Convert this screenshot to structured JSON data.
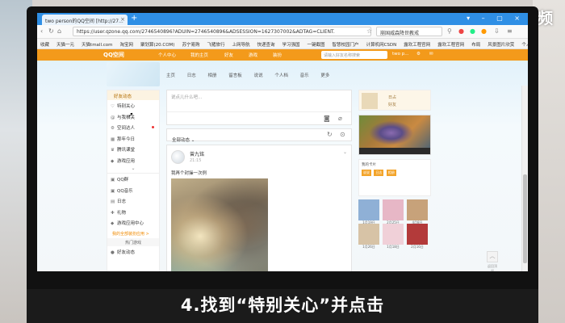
{
  "watermark": "天奇·视频",
  "caption": "4.找到“特别关心”并点击",
  "browser": {
    "tab_title": "two person的QQ空间 [http://27...",
    "url": "https://user.qzone.qq.com/2746540896?ADUIN=2746540896&ADSESSION=1627307002&ADTAG=CLIENT.",
    "search_placeholder": "崩国威森降世教戒",
    "bookmarks": [
      "收藏",
      "天猫一元",
      "天猫tmall.com",
      "淘宝网",
      "聚划算(20.COM)",
      "苏宁易购",
      "飞猪旅行",
      "上网导航",
      "快递查询",
      "学习强国",
      "一键截图",
      "智慧校园门户",
      "计算机网CSDN",
      "露欢工程官网",
      "露欢工程官网",
      "布局",
      "风景图片欣赏",
      "个人信息"
    ]
  },
  "qzone": {
    "logo": "QQ空间",
    "top_menu": [
      "个人中心",
      "我的主页",
      "好友",
      "游戏",
      "装扮"
    ],
    "search_placeholder": "请输入好友名称搜索",
    "user": "two p...",
    "nav": [
      "主页",
      "日志",
      "相册",
      "留言板",
      "说说",
      "个人档",
      "音乐",
      "更多"
    ]
  },
  "leftnav": {
    "header": "好友动态",
    "items": [
      {
        "icon": "heart-icon",
        "label": "特别关心",
        "dot": false
      },
      {
        "icon": "at-icon",
        "label": "与我相关",
        "dot": false
      },
      {
        "icon": "gear-icon",
        "label": "空间达人",
        "dot": true
      },
      {
        "icon": "calendar-icon",
        "label": "那年今日",
        "dot": false
      },
      {
        "icon": "trophy-icon",
        "label": "腾讯课堂",
        "dot": false
      },
      {
        "icon": "game-icon",
        "label": "游戏应用",
        "dot": false
      }
    ],
    "items2": [
      {
        "icon": "grid-icon",
        "label": "QQ群"
      },
      {
        "icon": "grid-icon",
        "label": "QQ音乐"
      },
      {
        "icon": "doc-icon",
        "label": "日志"
      },
      {
        "icon": "gift-icon",
        "label": "礼物"
      },
      {
        "icon": "game-icon",
        "label": "游戏应用中心"
      }
    ],
    "orange_link": "我的全部装扮应用 >",
    "sub_label": "热门游戏",
    "bottom_item": "好友动态"
  },
  "composer": {
    "placeholder": "说点儿什么吧..."
  },
  "feed": {
    "header": "全部动态",
    "chevron": "⌄"
  },
  "post": {
    "author": "曾九铭",
    "time": "21:15",
    "text": "我再个封操一次例"
  },
  "rightcol": {
    "box1_line1": "日占",
    "box1_line2": "好友",
    "sec_line1": "我的卡片",
    "sec_btns": [
      "说说",
      "日志",
      "相册"
    ],
    "tiles": [
      "1月19日",
      "2月25日",
      "4月8日",
      "1月26日",
      "1月18日",
      "2月16日"
    ]
  },
  "side_tool_label": "返回顶部",
  "colors": {
    "qzone_orange": "#f39a1b",
    "browser_blue": "#2f8fe5",
    "caption_bg": "#1b1b1b"
  }
}
